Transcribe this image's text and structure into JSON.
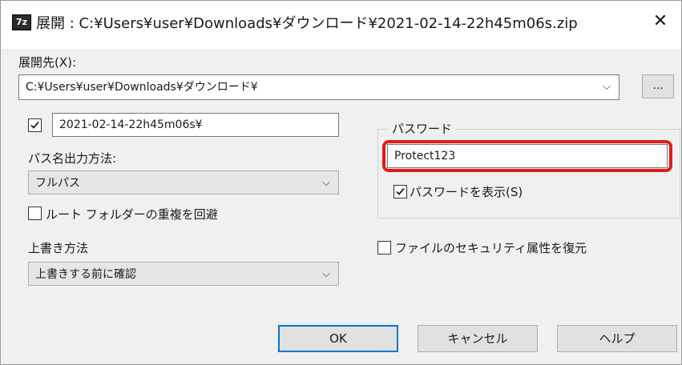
{
  "window": {
    "title": "展開 : C:¥Users¥user¥Downloads¥ダウンロード¥2021-02-14-22h45m06s.zip",
    "app_icon_text": "7z",
    "close_glyph": "✕"
  },
  "extract_to": {
    "label": "展開先(X):",
    "path": "C:¥Users¥user¥Downloads¥ダウンロード¥",
    "browse_label": "..."
  },
  "subfolder": {
    "checked": true,
    "value": "2021-02-14-22h45m06s¥"
  },
  "path_mode": {
    "label": "パス名出力方法:",
    "value": "フルパス"
  },
  "eliminate_duplicate": {
    "label": "ルート フォルダーの重複を回避",
    "checked": false
  },
  "overwrite": {
    "label": "上書き方法",
    "value": "上書きする前に確認"
  },
  "password": {
    "group_label": "パスワード",
    "value": "Protect123",
    "show_label": "パスワードを表示(S)",
    "show_checked": true
  },
  "restore_security": {
    "label": "ファイルのセキュリティ属性を復元",
    "checked": false
  },
  "buttons": {
    "ok": "OK",
    "cancel": "キャンセル",
    "help": "ヘルプ"
  },
  "icons": {
    "chevron": "chevron-down-icon",
    "check": "check-icon",
    "close": "close-icon"
  },
  "colors": {
    "highlight": "#e11b1b",
    "default_button_border": "#0078d7"
  }
}
